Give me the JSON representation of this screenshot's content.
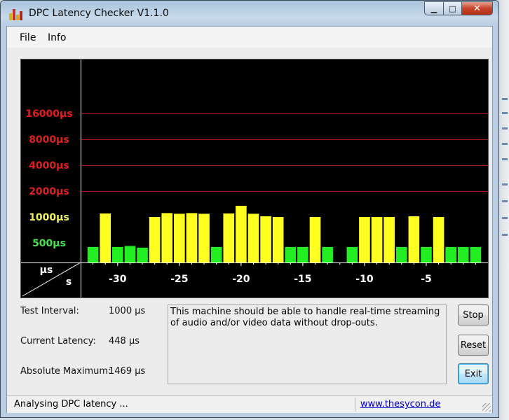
{
  "window": {
    "title": "DPC Latency Checker V1.1.0",
    "controls": {
      "minimize": "▁",
      "maximize": "□",
      "close": "✕"
    }
  },
  "menu": {
    "items": [
      "File",
      "Info"
    ]
  },
  "chart_data": {
    "type": "bar",
    "y_scale": "log",
    "y_unit": "µs",
    "x_unit": "s",
    "axis_corner_labels": {
      "y": "µs",
      "x": "s"
    },
    "y_ticks": [
      {
        "label": "16000µs",
        "value": 16000,
        "color": "#dd1f1f"
      },
      {
        "label": "8000µs",
        "value": 8000,
        "color": "#dd1f1f"
      },
      {
        "label": "4000µs",
        "value": 4000,
        "color": "#dd1f1f"
      },
      {
        "label": "2000µs",
        "value": 2000,
        "color": "#dd1f1f"
      },
      {
        "label": "1000µs",
        "value": 1000,
        "color": "#f2f25a"
      },
      {
        "label": "500µs",
        "value": 500,
        "color": "#4ddf4d"
      }
    ],
    "x_ticks": [
      {
        "label": "-30",
        "value": -30
      },
      {
        "label": "-25",
        "value": -25
      },
      {
        "label": "-20",
        "value": -20
      },
      {
        "label": "-15",
        "value": -15
      },
      {
        "label": "-10",
        "value": -10
      },
      {
        "label": "-5",
        "value": -5
      }
    ],
    "x_range": [
      -33,
      0
    ],
    "bar_x": [
      -32,
      -31,
      -30,
      -29,
      -28,
      -27,
      -26,
      -25,
      -24,
      -23,
      -22,
      -21,
      -20,
      -19,
      -18,
      -17,
      -16,
      -15,
      -14,
      -13,
      -12,
      -11,
      -10,
      -9,
      -8,
      -7,
      -6,
      -5,
      -4,
      -3,
      -2,
      -1
    ],
    "values": [
      448,
      1100,
      448,
      460,
      440,
      1000,
      1110,
      1090,
      1110,
      1090,
      448,
      1100,
      1350,
      1090,
      1020,
      1000,
      448,
      448,
      1000,
      448,
      235,
      448,
      1000,
      1000,
      1000,
      448,
      1020,
      448,
      1000,
      448,
      448,
      448
    ],
    "threshold_colors": {
      "green_below": 600,
      "yellow_below": 1800,
      "green": "#22ee22",
      "yellow": "#ffff22",
      "red": "#ee2222"
    },
    "grid_color": "#aa1818"
  },
  "info": {
    "test_interval_label": "Test Interval:",
    "test_interval_value": "1000 µs",
    "current_latency_label": "Current Latency:",
    "current_latency_value": "448 µs",
    "absolute_max_label": "Absolute Maximum:",
    "absolute_max_value": "1469 µs"
  },
  "message": "This machine should be able to handle real-time streaming of audio and/or video data without drop-outs.",
  "buttons": {
    "stop": "Stop",
    "reset": "Reset",
    "exit": "Exit"
  },
  "status": {
    "text": "Analysing DPC latency ...",
    "link": "www.thesycon.de"
  }
}
